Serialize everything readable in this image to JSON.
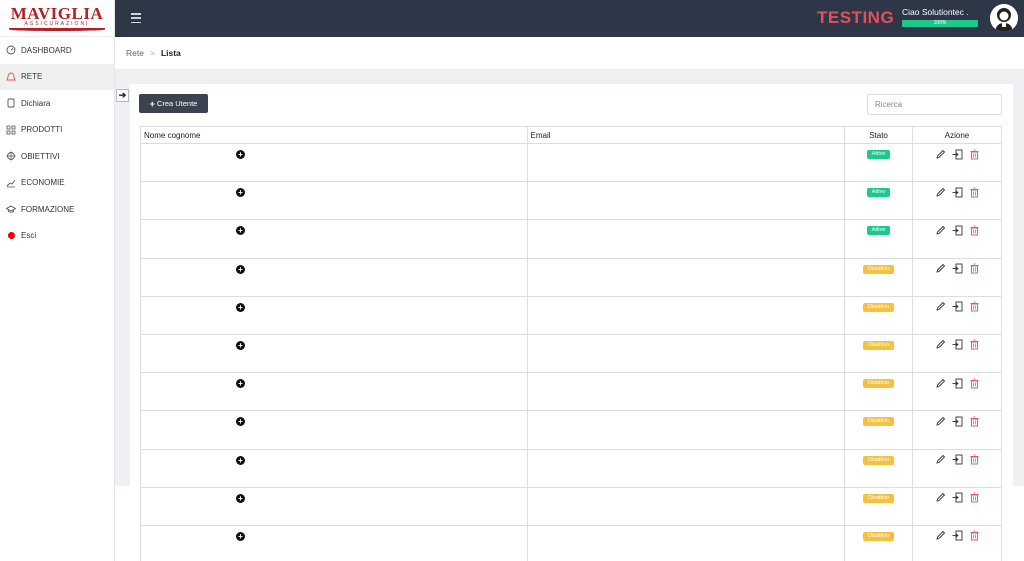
{
  "brand": {
    "name": "MAVIGLIA",
    "subtitle": "ASSICURAZIONI",
    "color": "#b21f24"
  },
  "sidebar": {
    "items": [
      {
        "label": "DASHBOARD",
        "icon": "gauge-icon"
      },
      {
        "label": "RETE",
        "icon": "network-icon",
        "active": true
      },
      {
        "label": "Dichiara",
        "icon": "document-icon"
      },
      {
        "label": "PRODOTTI",
        "icon": "grid-icon"
      },
      {
        "label": "OBIETTIVI",
        "icon": "target-icon"
      },
      {
        "label": "ECONOMIE",
        "icon": "chart-line-icon"
      },
      {
        "label": "FORMAZIONE",
        "icon": "graduation-cap-icon"
      },
      {
        "label": "Esci",
        "icon": "red-dot-icon"
      }
    ]
  },
  "topbar": {
    "environment": "TESTING",
    "user_name": "Ciao Solutiontec .",
    "progress_label": "100%",
    "progress_value": 1.0
  },
  "breadcrumb": {
    "parent": "Rete",
    "separator": ">",
    "current": "Lista"
  },
  "toolbar": {
    "create_label": "Crea Utente",
    "search_placeholder": "Ricerca"
  },
  "table": {
    "headers": {
      "name": "Nome cognome",
      "email": "Email",
      "status": "Stato",
      "actions": "Azione"
    },
    "rows": [
      {
        "status": "Attivo",
        "status_color": "green"
      },
      {
        "status": "Attivo",
        "status_color": "green"
      },
      {
        "status": "Attivo",
        "status_color": "green"
      },
      {
        "status": "Disattivo",
        "status_color": "yellow"
      },
      {
        "status": "Disattivo",
        "status_color": "yellow"
      },
      {
        "status": "Disattivo",
        "status_color": "yellow"
      },
      {
        "status": "Disattivo",
        "status_color": "yellow"
      },
      {
        "status": "Disattivo",
        "status_color": "yellow"
      },
      {
        "status": "Disattivo",
        "status_color": "yellow"
      },
      {
        "status": "Disattivo",
        "status_color": "yellow"
      },
      {
        "status": "Disattivo",
        "status_color": "yellow"
      }
    ]
  },
  "colors": {
    "topbar": "#2d3748",
    "testing": "#e4505a",
    "active_badge": "#1cc88a",
    "inactive_badge": "#f6c23e",
    "delete_icon": "#e4505a"
  }
}
